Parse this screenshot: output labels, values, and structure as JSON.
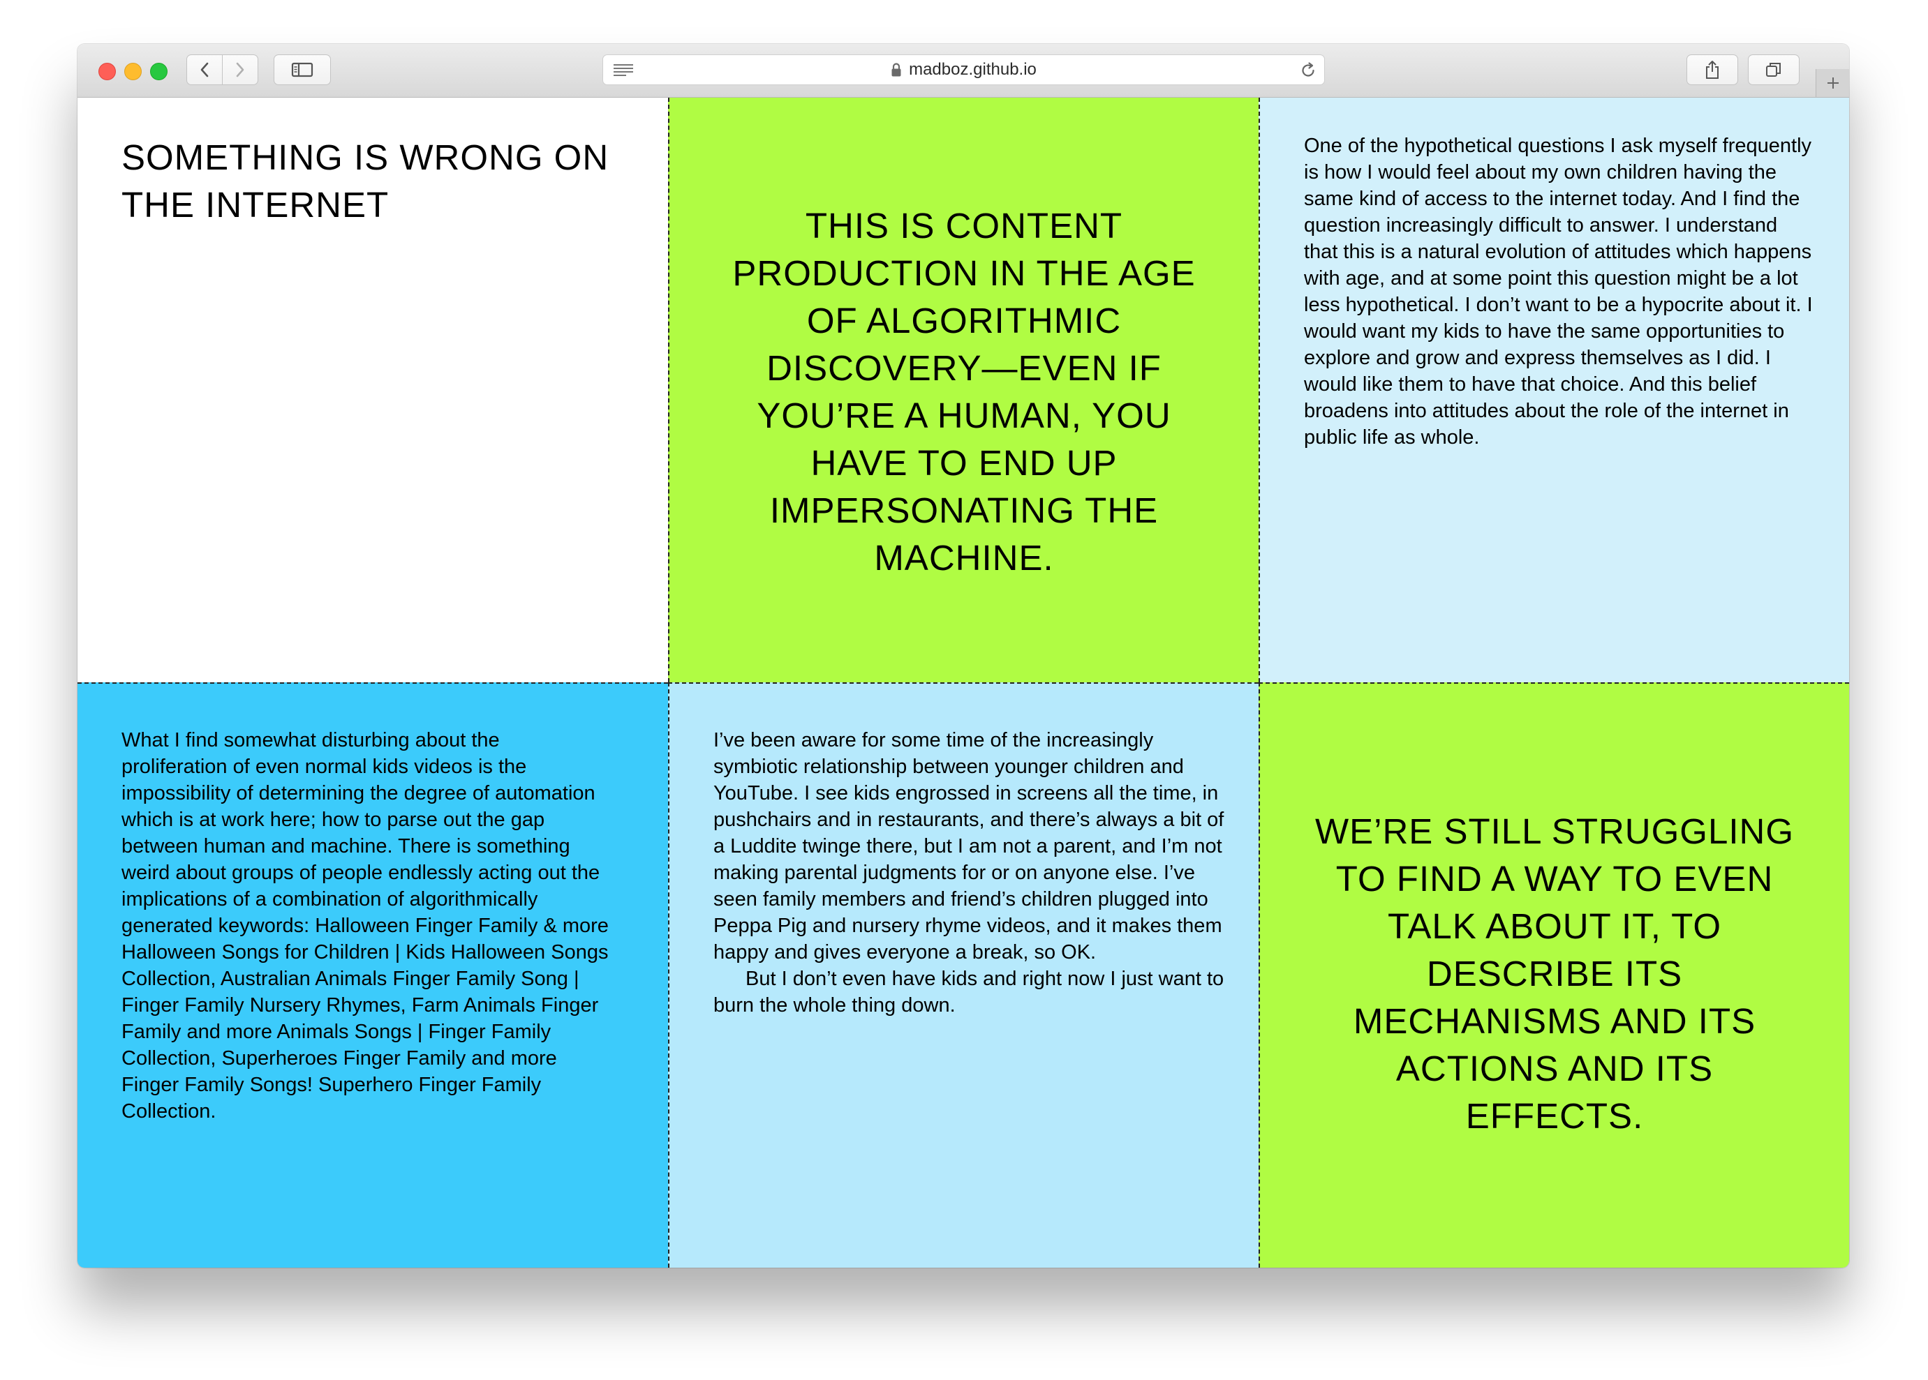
{
  "browser": {
    "url": "madboz.github.io",
    "icons": {
      "back": "chevron-left-icon",
      "forward": "chevron-right-icon",
      "sidebar": "sidebar-icon",
      "reader": "reader-mode-icon",
      "lock": "lock-icon",
      "reload": "reload-icon",
      "share": "share-icon",
      "tabs": "tabs-overview-icon",
      "new_tab": "plus-icon"
    }
  },
  "cells": {
    "title": "SOMETHING IS WRONG ON THE INTERNET",
    "quote1": "THIS IS CONTENT PRODUCTION IN THE AGE OF ALGORITHMIC DISCOVERY—EVEN IF YOU’RE A HUMAN, YOU HAVE TO END UP IMPERSONATING THE MACHINE.",
    "paragraph_hypothetical": "One of the hypothetical questions I ask myself frequently is how I would feel about my own children having the same kind of access to the internet today. And I find the question increasingly difficult to answer. I understand that this is a natural evolution of attitudes which happens with age, and at some point this question might be a lot less hypothetical. I don’t want to be a hypocrite about it. I would want my kids to have the same opportunities to explore and grow and express themselves as I did. I would like them to have that choice. And this belief broadens into attitudes about the role of the internet in public life as whole.",
    "paragraph_disturbing": "What I find somewhat disturbing about the proliferation of even normal kids videos is the impossibility of determining the degree of automation which is at work here; how to parse out the gap between human and machine. There is something weird about groups of people endlessly acting out the implications of a combination of algorithmically generated keywords: Halloween Finger Family & more Halloween Songs for Children | Kids Halloween Songs Collection, Australian Animals Finger Family Song | Finger Family Nursery Rhymes, Farm Animals Finger Family and more Animals Songs | Finger Family Collection, Superheroes Finger Family and more Finger Family Songs! Superhero Finger Family Collection.",
    "paragraph_aware": "I’ve been aware for some time of the increasingly symbiotic relationship between younger children and YouTube. I see kids engrossed in screens all the time, in pushchairs and in restaurants, and there’s always a bit of a Luddite twinge there, but I am not a parent, and I’m not making parental judgments for or on anyone else. I’ve seen family members and friend’s children plugged into Peppa Pig and nursery rhyme videos, and it makes them happy and gives everyone a break, so OK.",
    "paragraph_burn": "But I don’t even have kids and right now I just want to burn the whole thing down.",
    "quote2": "WE’RE STILL STRUGGLING TO FIND A WAY TO EVEN TALK ABOUT IT, TO DESCRIBE ITS MECHANISMS AND ITS ACTIONS AND ITS EFFECTS."
  },
  "colors": {
    "lime": "#b0fc43",
    "pale_blue": "#d2f0fb",
    "sky_blue": "#3ccbfb",
    "light_blue": "#b6e9fc",
    "white": "#ffffff"
  }
}
